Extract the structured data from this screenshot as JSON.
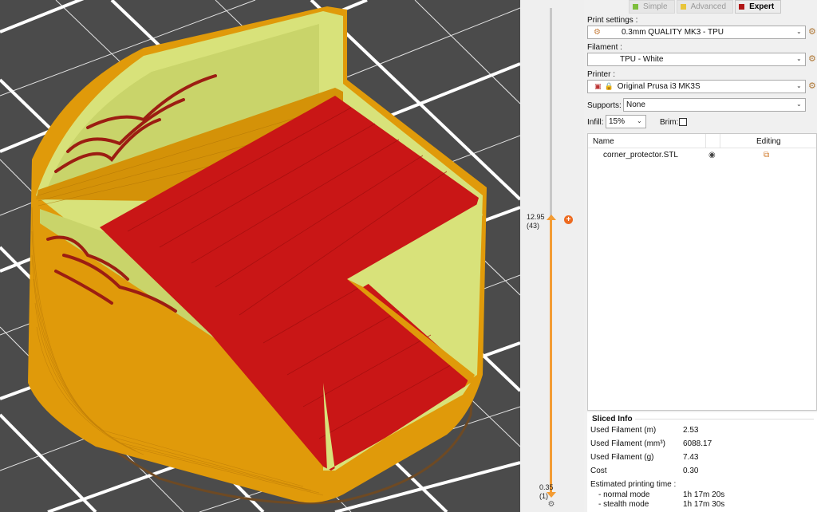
{
  "modes": [
    {
      "label": "Simple",
      "color": "#7dbe3c",
      "active": false
    },
    {
      "label": "Advanced",
      "color": "#e8c53a",
      "active": false
    },
    {
      "label": "Expert",
      "color": "#b01515",
      "active": true
    }
  ],
  "print_settings": {
    "label": "Print settings :",
    "value": "0.3mm QUALITY MK3 - TPU"
  },
  "filament": {
    "label": "Filament :",
    "value": "TPU - White"
  },
  "printer": {
    "label": "Printer :",
    "value": "Original Prusa i3 MK3S"
  },
  "supports": {
    "label": "Supports:",
    "value": "None"
  },
  "infill": {
    "label": "Infill:",
    "value": "15%"
  },
  "brim": {
    "label": "Brim:",
    "checked": false
  },
  "object_list": {
    "col_name": "Name",
    "col_editing": "Editing",
    "objects": [
      {
        "name": "corner_protector.STL"
      }
    ]
  },
  "layer_slider": {
    "top_value": "12.95",
    "top_layer": "(43)",
    "bottom_value": "0.35",
    "bottom_layer": "(1)",
    "accent": "#f39c34"
  },
  "sliced_info": {
    "title": "Sliced Info",
    "rows": [
      {
        "k": "Used Filament (m)",
        "v": "2.53"
      },
      {
        "k": "Used Filament (mm³)",
        "v": "6088.17"
      },
      {
        "k": "Used Filament (g)",
        "v": "7.43"
      },
      {
        "k": "Cost",
        "v": "0.30"
      },
      {
        "k": "Estimated printing time :",
        "v": ""
      },
      {
        "k": "  - normal mode",
        "v": "1h 17m 20s"
      },
      {
        "k": "  - stealth mode",
        "v": "1h 17m 30s"
      }
    ]
  },
  "colors": {
    "perimeter": "#e09a0a",
    "top_infill": "#c91616",
    "inner": "#d8e27a",
    "skirt": "#6e4a24",
    "bed": "#4b4b4b",
    "grid": "#ffffff"
  }
}
